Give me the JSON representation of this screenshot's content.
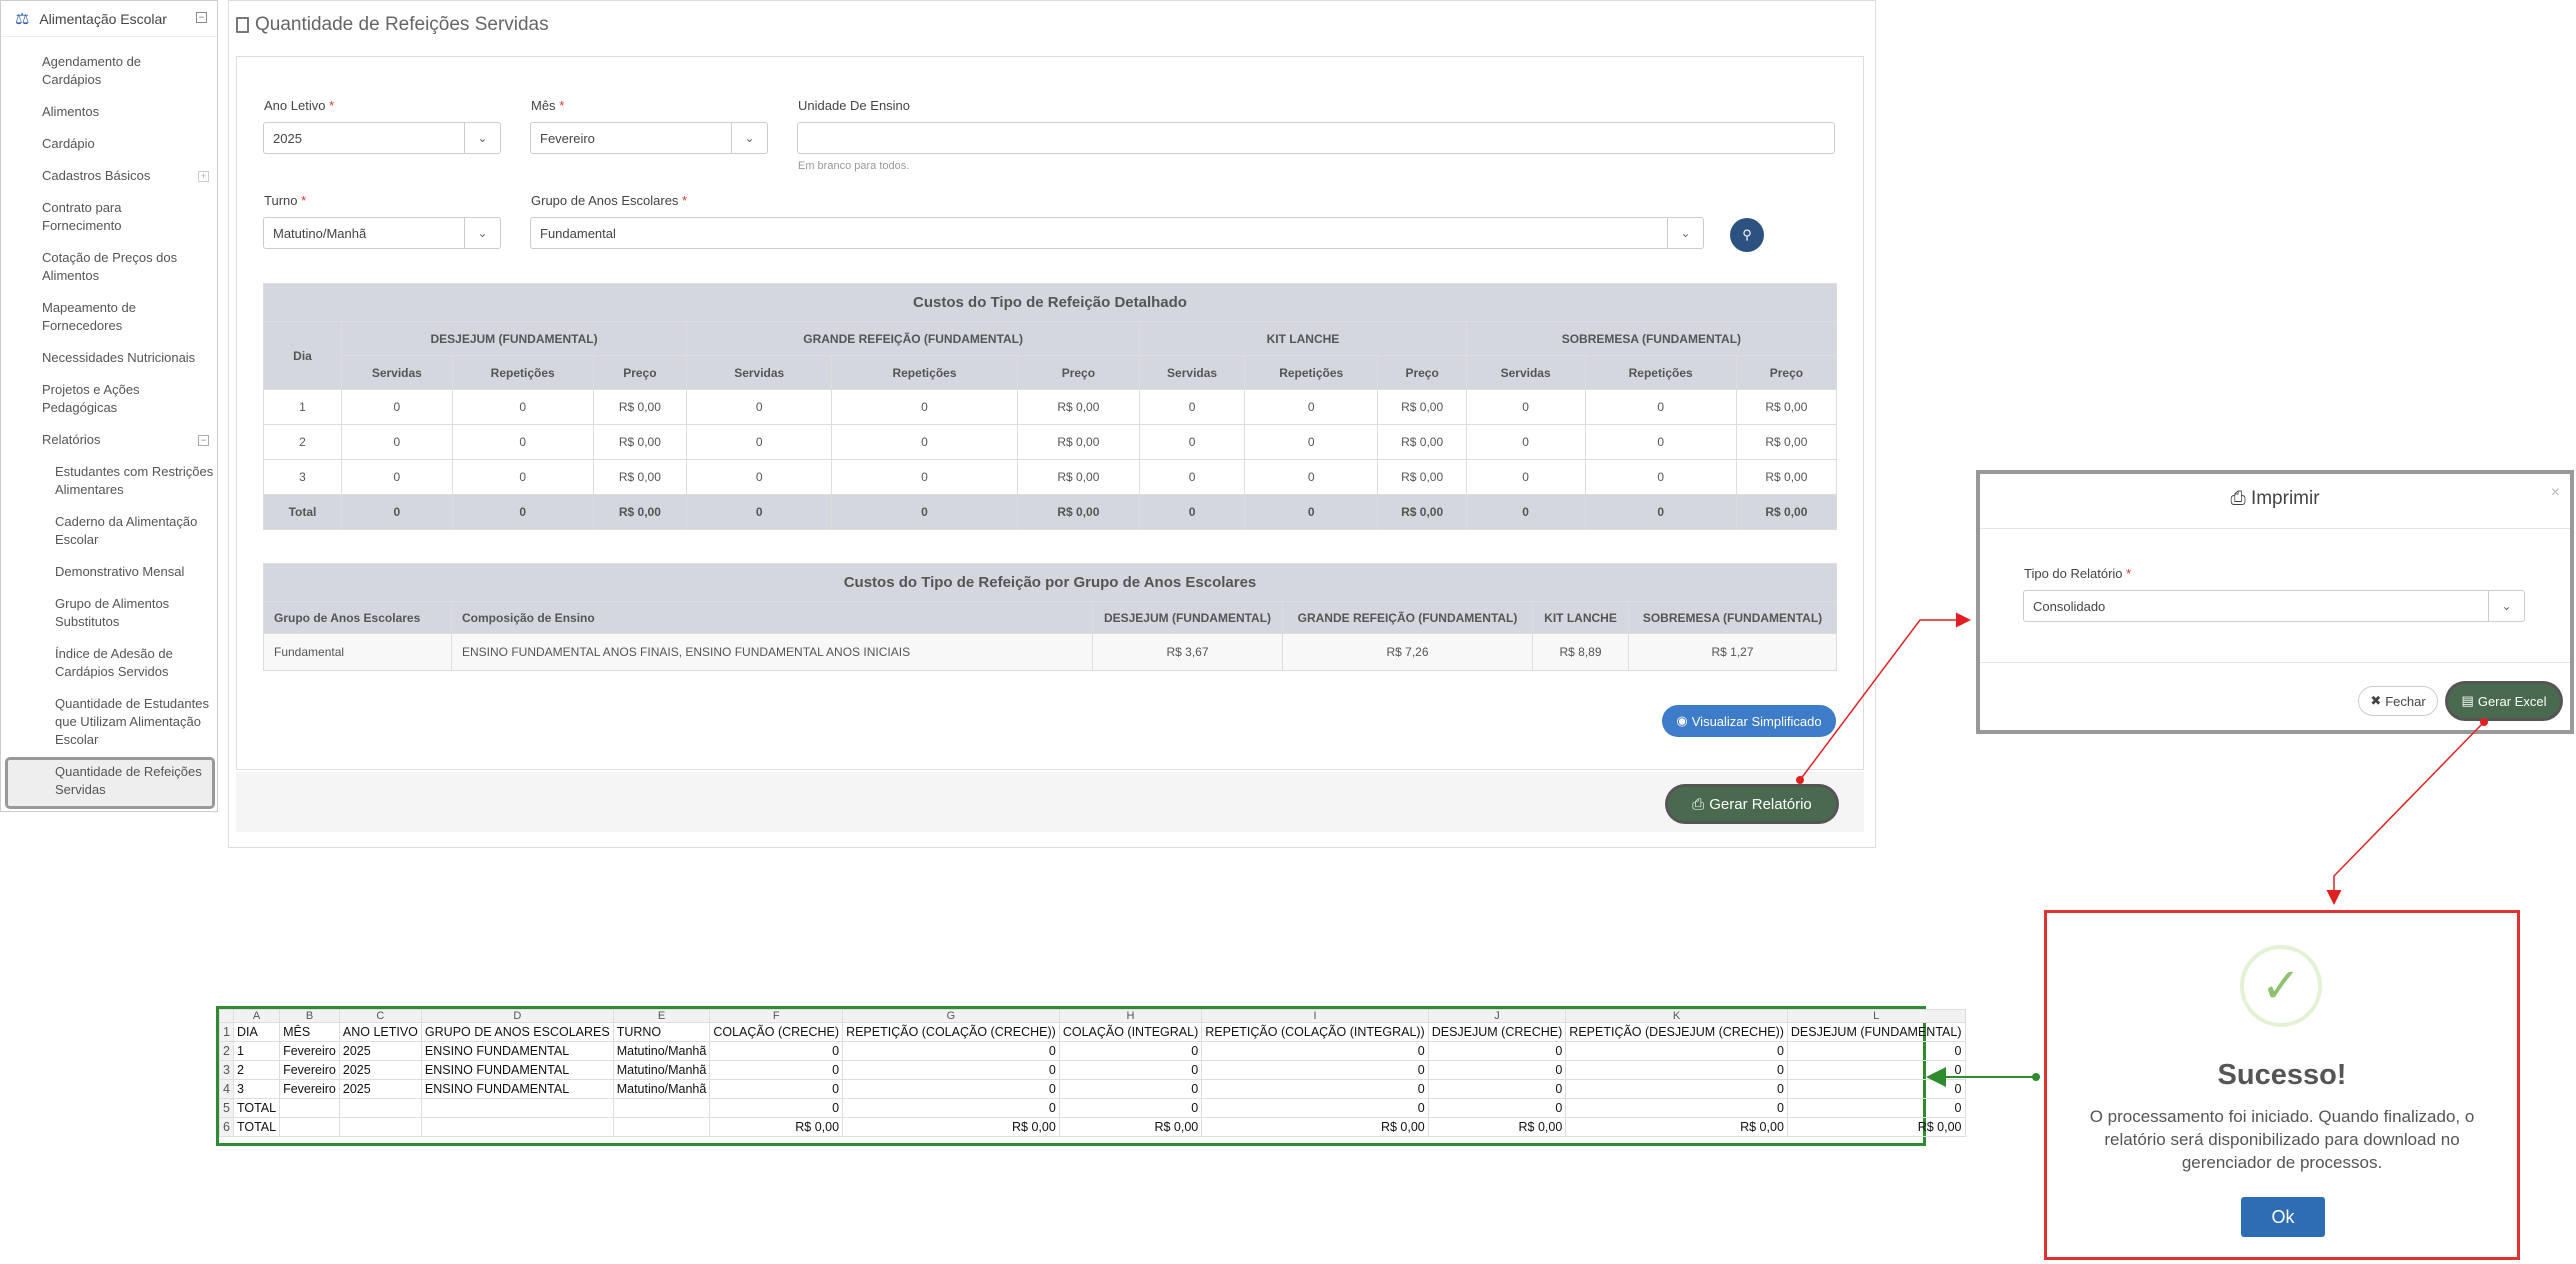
{
  "sidebar": {
    "header": "Alimentação Escolar",
    "items": [
      "Agendamento de Cardápios",
      "Alimentos",
      "Cardápio",
      "Cadastros Básicos",
      "Contrato para Fornecimento",
      "Cotação de Preços dos Alimentos",
      "Mapeamento de Fornecedores",
      "Necessidades Nutricionais",
      "Projetos e Ações Pedagógicas",
      "Relatórios"
    ],
    "subitems": [
      "Estudantes com Restrições Alimentares",
      "Caderno da Alimentação Escolar",
      "Demonstrativo Mensal",
      "Grupo de Alimentos Substitutos",
      "Índice de Adesão de Cardápios Servidos",
      "Quantidade de Estudantes que Utilizam Alimentação Escolar",
      "Quantidade de Refeições Servidas"
    ]
  },
  "page": {
    "title": "Quantidade de Refeições Servidas"
  },
  "form": {
    "ano_label": "Ano Letivo",
    "ano_value": "2025",
    "mes_label": "Mês",
    "mes_value": "Fevereiro",
    "unidade_label": "Unidade De Ensino",
    "unidade_value": "",
    "unidade_help": "Em branco para todos.",
    "turno_label": "Turno",
    "turno_value": "Matutino/Manhã",
    "grupo_label": "Grupo de Anos Escolares",
    "grupo_value": "Fundamental",
    "required_mark": "*"
  },
  "table1": {
    "caption": "Custos do Tipo de Refeição Detalhado",
    "dia_header": "Dia",
    "groups": [
      "DESJEJUM (FUNDAMENTAL)",
      "GRANDE REFEIÇÃO (FUNDAMENTAL)",
      "KIT LANCHE",
      "SOBREMESA (FUNDAMENTAL)"
    ],
    "subheaders": [
      "Servidas",
      "Repetições",
      "Preço"
    ],
    "rows": [
      [
        "1",
        "0",
        "0",
        "R$ 0,00",
        "0",
        "0",
        "R$ 0,00",
        "0",
        "0",
        "R$ 0,00",
        "0",
        "0",
        "R$ 0,00"
      ],
      [
        "2",
        "0",
        "0",
        "R$ 0,00",
        "0",
        "0",
        "R$ 0,00",
        "0",
        "0",
        "R$ 0,00",
        "0",
        "0",
        "R$ 0,00"
      ],
      [
        "3",
        "0",
        "0",
        "R$ 0,00",
        "0",
        "0",
        "R$ 0,00",
        "0",
        "0",
        "R$ 0,00",
        "0",
        "0",
        "R$ 0,00"
      ]
    ],
    "total": [
      "Total",
      "0",
      "0",
      "R$ 0,00",
      "0",
      "0",
      "R$ 0,00",
      "0",
      "0",
      "R$ 0,00",
      "0",
      "0",
      "R$ 0,00"
    ]
  },
  "table2": {
    "caption": "Custos do Tipo de Refeição por Grupo de Anos Escolares",
    "headers": [
      "Grupo de Anos Escolares",
      "Composição de Ensino",
      "DESJEJUM (FUNDAMENTAL)",
      "GRANDE REFEIÇÃO (FUNDAMENTAL)",
      "KIT LANCHE",
      "SOBREMESA (FUNDAMENTAL)"
    ],
    "row": [
      "Fundamental",
      "ENSINO FUNDAMENTAL ANOS FINAIS, ENSINO FUNDAMENTAL ANOS INICIAIS",
      "R$ 3,67",
      "R$ 7,26",
      "R$ 8,89",
      "R$ 1,27"
    ]
  },
  "buttons": {
    "visualizar": "Visualizar Simplificado",
    "gerar": "Gerar Relatório"
  },
  "modal": {
    "title": "Imprimir",
    "close": "×",
    "tipo_label": "Tipo do Relatório",
    "tipo_value": "Consolidado",
    "fechar": "Fechar",
    "excel": "Gerar Excel"
  },
  "success": {
    "title": "Sucesso!",
    "text": "O processamento foi iniciado. Quando finalizado, o relatório será disponibilizado para download no gerenciador de processos.",
    "ok": "Ok"
  },
  "sheet": {
    "cols": [
      "A",
      "B",
      "C",
      "D",
      "E",
      "F",
      "G",
      "H",
      "I",
      "J",
      "K",
      "L"
    ],
    "header": [
      "DIA",
      "MÊS",
      "ANO LETIVO",
      "GRUPO DE ANOS ESCOLARES",
      "TURNO",
      "COLAÇÃO (CRECHE)",
      "REPETIÇÃO (COLAÇÃO (CRECHE))",
      "COLAÇÃO (INTEGRAL)",
      "REPETIÇÃO (COLAÇÃO (INTEGRAL))",
      "DESJEJUM (CRECHE)",
      "REPETIÇÃO (DESJEJUM (CRECHE))",
      "DESJEJUM (FUNDAMENTAL)"
    ],
    "rows": [
      [
        "1",
        "Fevereiro",
        "2025",
        "ENSINO FUNDAMENTAL",
        "Matutino/Manhã",
        "0",
        "0",
        "0",
        "0",
        "0",
        "0",
        "0"
      ],
      [
        "2",
        "Fevereiro",
        "2025",
        "ENSINO FUNDAMENTAL",
        "Matutino/Manhã",
        "0",
        "0",
        "0",
        "0",
        "0",
        "0",
        "0"
      ],
      [
        "3",
        "Fevereiro",
        "2025",
        "ENSINO FUNDAMENTAL",
        "Matutino/Manhã",
        "0",
        "0",
        "0",
        "0",
        "0",
        "0",
        "0"
      ],
      [
        "TOTAL",
        "",
        "",
        "",
        "",
        "0",
        "0",
        "0",
        "0",
        "0",
        "0",
        "0"
      ],
      [
        "TOTAL",
        "",
        "",
        "",
        "",
        "R$ 0,00",
        "R$ 0,00",
        "R$ 0,00",
        "R$ 0,00",
        "R$ 0,00",
        "R$ 0,00",
        "R$ 0,00"
      ]
    ]
  },
  "colors": {
    "arrow_red": "#e02020",
    "arrow_green": "#2e8b2e",
    "primary": "#2c5282",
    "success_green": "#8dc26f"
  }
}
